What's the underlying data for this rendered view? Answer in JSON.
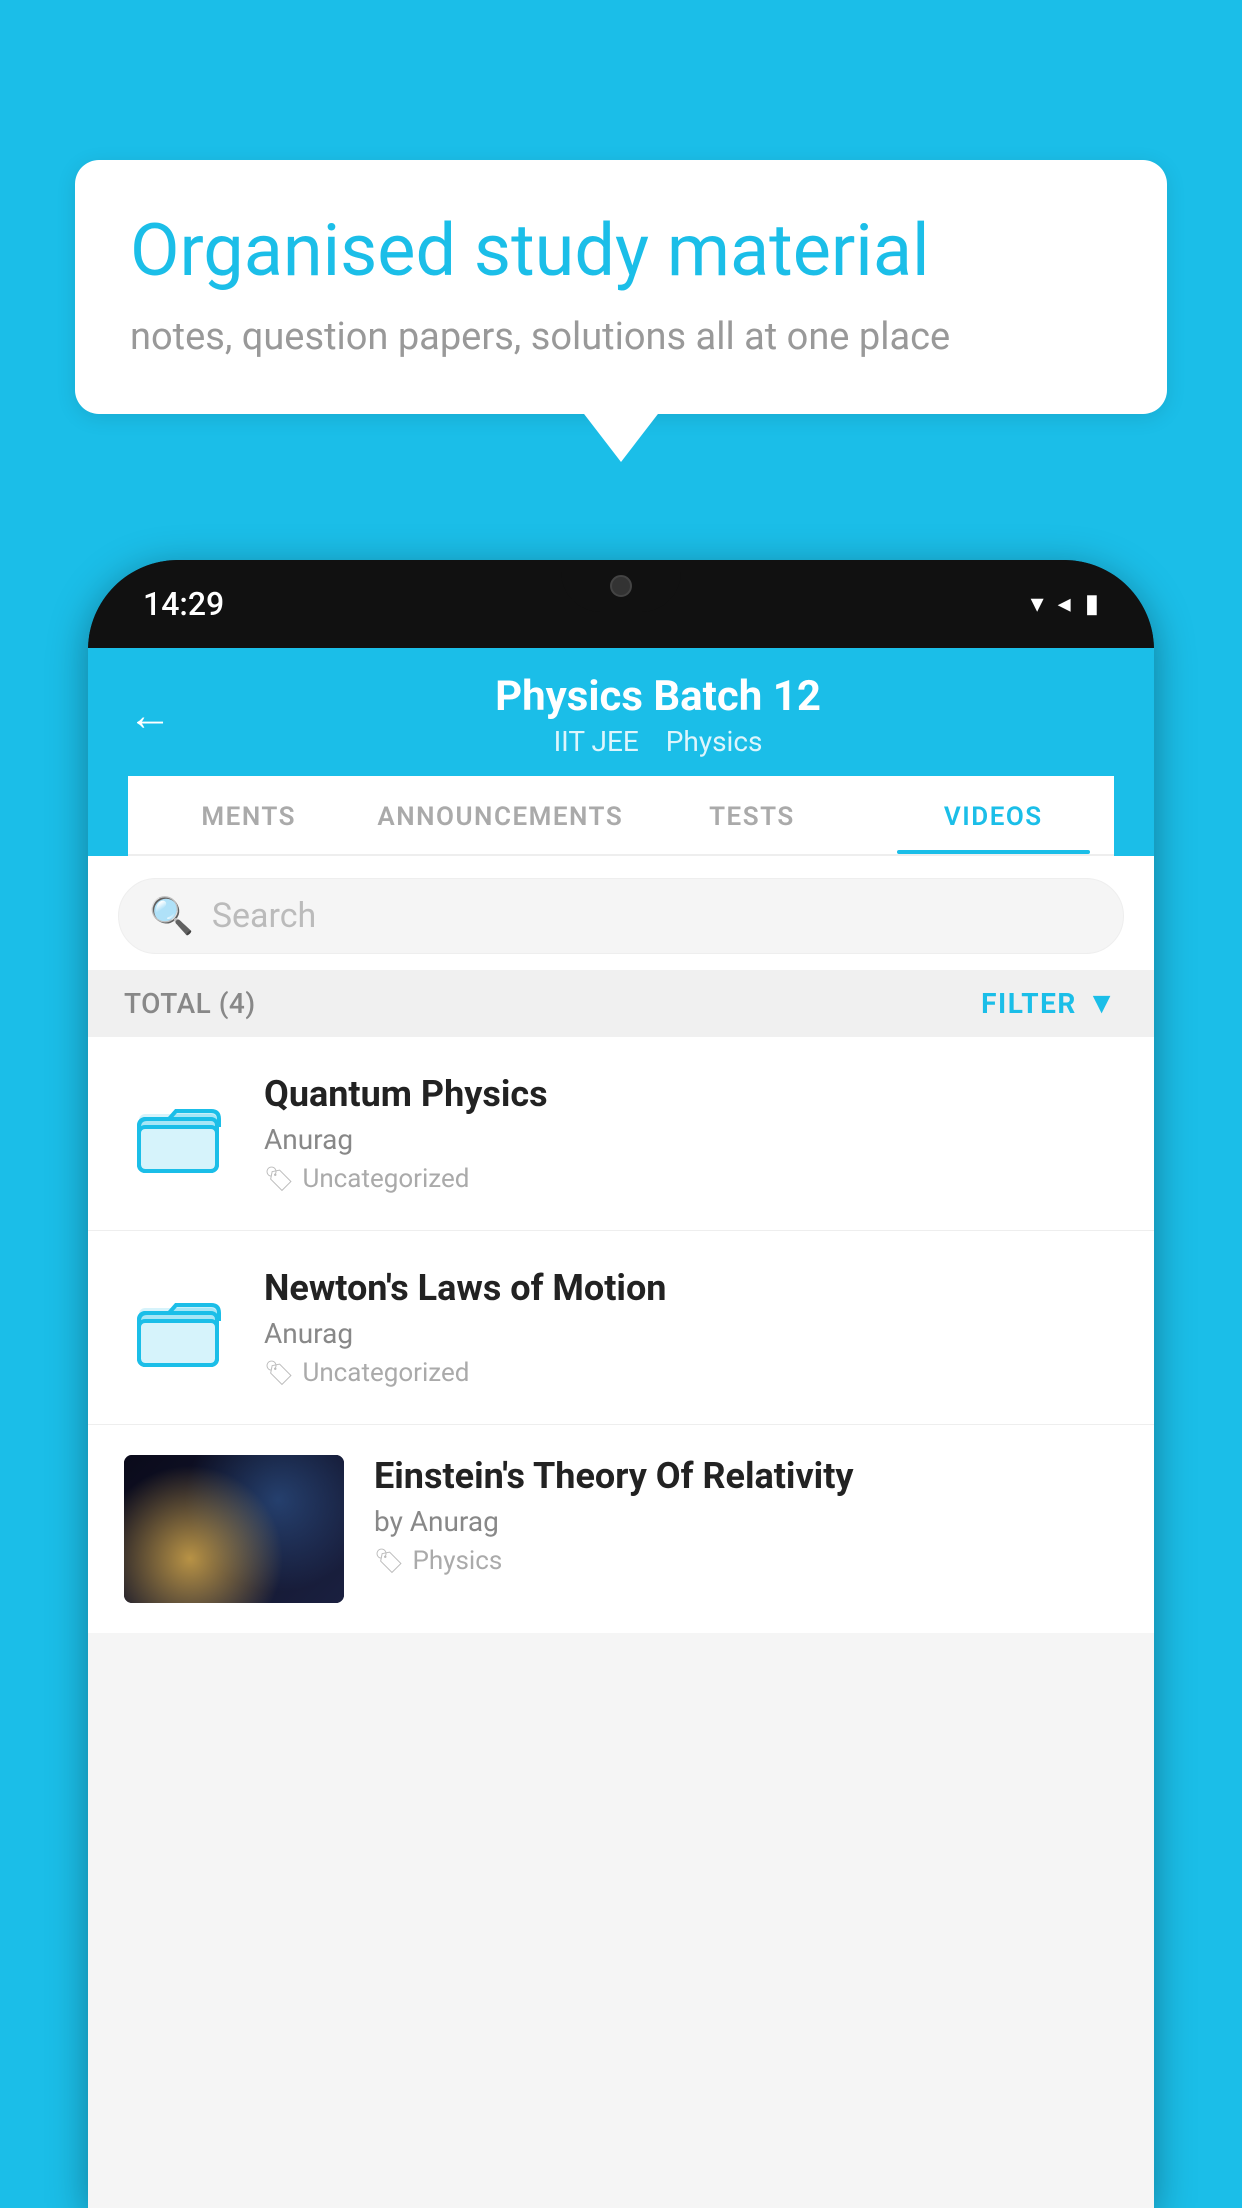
{
  "background_color": "#1BBEE8",
  "speech_bubble": {
    "title": "Organised study material",
    "subtitle": "notes, question papers, solutions all at one place"
  },
  "phone": {
    "status_bar": {
      "time": "14:29",
      "wifi": "▾",
      "signal": "◂",
      "battery": "▮"
    },
    "header": {
      "back_label": "←",
      "title": "Physics Batch 12",
      "subtitle_left": "IIT JEE",
      "subtitle_right": "Physics"
    },
    "tabs": [
      {
        "label": "MENTS",
        "active": false
      },
      {
        "label": "ANNOUNCEMENTS",
        "active": false
      },
      {
        "label": "TESTS",
        "active": false
      },
      {
        "label": "VIDEOS",
        "active": true
      }
    ],
    "search": {
      "placeholder": "Search"
    },
    "filter": {
      "total_label": "TOTAL (4)",
      "filter_label": "FILTER"
    },
    "videos": [
      {
        "id": 1,
        "title": "Quantum Physics",
        "author": "Anurag",
        "tag": "Uncategorized",
        "has_thumb": false
      },
      {
        "id": 2,
        "title": "Newton's Laws of Motion",
        "author": "Anurag",
        "tag": "Uncategorized",
        "has_thumb": false
      },
      {
        "id": 3,
        "title": "Einstein's Theory Of Relativity",
        "author": "by Anurag",
        "tag": "Physics",
        "has_thumb": true
      }
    ]
  }
}
